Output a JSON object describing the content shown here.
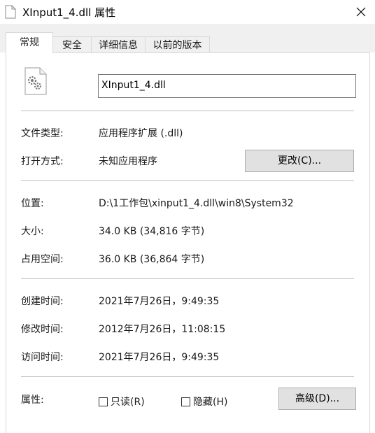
{
  "window": {
    "title": "XInput1_4.dll 属性",
    "close_glyph": "✕"
  },
  "tabs": [
    {
      "label": "常规",
      "active": true
    },
    {
      "label": "安全",
      "active": false
    },
    {
      "label": "详细信息",
      "active": false
    },
    {
      "label": "以前的版本",
      "active": false
    }
  ],
  "file": {
    "name": "XInput1_4.dll",
    "icon": "dll-gear-file-icon"
  },
  "properties": {
    "type_label": "文件类型:",
    "type_value": "应用程序扩展 (.dll)",
    "opens_label": "打开方式:",
    "opens_value": "未知应用程序",
    "change_button": "更改(C)...",
    "location_label": "位置:",
    "location_value": "D:\\1工作包\\xinput1_4.dll\\win8\\System32",
    "size_label": "大小:",
    "size_value": "34.0 KB (34,816 字节)",
    "disk_label": "占用空间:",
    "disk_value": "36.0 KB (36,864 字节)",
    "created_label": "创建时间:",
    "created_value": "2021年7月26日，9:49:35",
    "modified_label": "修改时间:",
    "modified_value": "2012年7月26日，11:08:15",
    "accessed_label": "访问时间:",
    "accessed_value": "2021年7月26日，9:49:35",
    "attributes_label": "属性:",
    "readonly_label": "只读(R)",
    "readonly_checked": false,
    "hidden_label": "隐藏(H)",
    "hidden_checked": false,
    "advanced_button": "高级(D)..."
  }
}
